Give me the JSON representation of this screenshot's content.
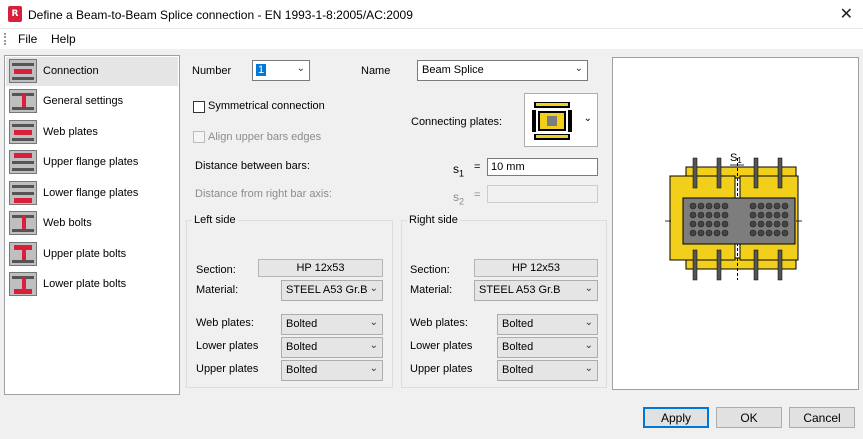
{
  "window": {
    "title": "Define a Beam-to-Beam Splice connection - EN 1993-1-8:2005/AC:2009",
    "close_glyph": "✕",
    "app_icon_letter": "R"
  },
  "menu": {
    "file": "File",
    "help": "Help"
  },
  "sidebar": {
    "items": [
      {
        "label": "Connection"
      },
      {
        "label": "General settings"
      },
      {
        "label": "Web plates"
      },
      {
        "label": "Upper flange plates"
      },
      {
        "label": "Lower flange plates"
      },
      {
        "label": "Web bolts"
      },
      {
        "label": "Upper plate bolts"
      },
      {
        "label": "Lower plate bolts"
      }
    ]
  },
  "form": {
    "number_label": "Number",
    "number_value": "1",
    "name_label": "Name",
    "name_value": "Beam Splice",
    "symmetrical_label": "Symmetrical connection",
    "align_label": "Align upper bars edges",
    "connecting_plates_label": "Connecting plates:",
    "distance_label": "Distance between bars:",
    "s1_label": "s",
    "s1_sub": "1",
    "equals": "=",
    "s1_value": "10 mm",
    "distance_right_label": "Distance from right bar axis:",
    "s2_label": "s",
    "s2_sub": "2"
  },
  "left_side": {
    "title": "Left side",
    "section_label": "Section:",
    "section_value": "HP 12x53",
    "material_label": "Material:",
    "material_value": "STEEL A53 Gr.B",
    "web_plates_label": "Web plates:",
    "web_plates_value": "Bolted",
    "lower_plates_label": "Lower plates",
    "lower_plates_value": "Bolted",
    "upper_plates_label": "Upper plates",
    "upper_plates_value": "Bolted"
  },
  "right_side": {
    "title": "Right side",
    "section_label": "Section:",
    "section_value": "HP 12x53",
    "material_label": "Material:",
    "material_value": "STEEL A53 Gr.B",
    "web_plates_label": "Web plates:",
    "web_plates_value": "Bolted",
    "lower_plates_label": "Lower plates",
    "lower_plates_value": "Bolted",
    "upper_plates_label": "Upper plates",
    "upper_plates_value": "Bolted"
  },
  "preview": {
    "dimension_label": "S",
    "dimension_sub": "1"
  },
  "buttons": {
    "apply": "Apply",
    "ok": "OK",
    "cancel": "Cancel"
  },
  "colors": {
    "accent": "#0078d7",
    "beam_yellow": "#f2cf1b",
    "plate_gray": "#7d7d7d",
    "icon_red": "#d8203c"
  }
}
